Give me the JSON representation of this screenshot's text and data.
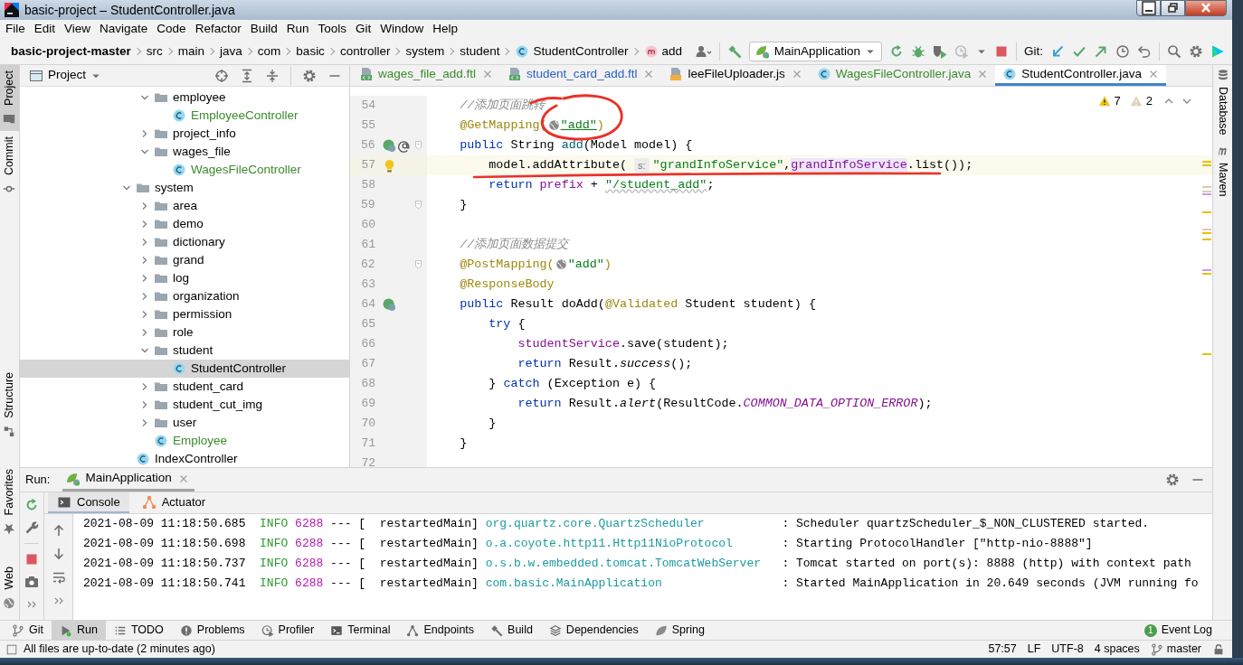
{
  "window": {
    "title": "basic-project – StudentController.java"
  },
  "menu": [
    "File",
    "Edit",
    "View",
    "Navigate",
    "Code",
    "Refactor",
    "Build",
    "Run",
    "Tools",
    "Git",
    "Window",
    "Help"
  ],
  "breadcrumbs": [
    {
      "label": "basic-project-master",
      "kind": "project"
    },
    {
      "label": "src",
      "kind": "dir"
    },
    {
      "label": "main",
      "kind": "dir"
    },
    {
      "label": "java",
      "kind": "dir"
    },
    {
      "label": "com",
      "kind": "dir"
    },
    {
      "label": "basic",
      "kind": "dir"
    },
    {
      "label": "controller",
      "kind": "dir"
    },
    {
      "label": "system",
      "kind": "dir"
    },
    {
      "label": "student",
      "kind": "dir"
    },
    {
      "label": "StudentController",
      "kind": "class"
    },
    {
      "label": "add",
      "kind": "method"
    }
  ],
  "toolbar": {
    "run_config": "MainApplication",
    "vcs_label": "Git:"
  },
  "left_stripe_top": [
    {
      "label": "Project",
      "kind": "project",
      "selected": true
    },
    {
      "label": "Commit",
      "kind": "commit",
      "selected": false
    }
  ],
  "left_stripe_bottom": [
    {
      "label": "Structure",
      "kind": "structure",
      "selected": false
    },
    {
      "label": "Favorites",
      "kind": "favorites",
      "selected": false
    },
    {
      "label": "Web",
      "kind": "web",
      "selected": false
    }
  ],
  "project_panel": {
    "title": "Project",
    "tree": [
      {
        "children": [
          {
            "label": "employee",
            "kind": "folder",
            "expanded": true,
            "selected": false,
            "children": [
              {
                "label": "EmployeeController",
                "kind": "class",
                "color": "#3c8a2e",
                "selected": false
              }
            ]
          },
          {
            "label": "project_info",
            "kind": "folder",
            "expanded": false,
            "selected": false
          },
          {
            "label": "wages_file",
            "kind": "folder",
            "expanded": true,
            "selected": false,
            "children": [
              {
                "label": "WagesFileController",
                "kind": "class",
                "color": "#3c8a2e",
                "selected": false
              }
            ]
          }
        ]
      },
      {
        "label": "system",
        "kind": "folder",
        "expanded": true,
        "selected": false,
        "children": [
          {
            "label": "area",
            "kind": "folder",
            "expanded": false,
            "selected": false
          },
          {
            "label": "demo",
            "kind": "folder",
            "expanded": false,
            "selected": false
          },
          {
            "label": "dictionary",
            "kind": "folder",
            "expanded": false,
            "selected": false
          },
          {
            "label": "grand",
            "kind": "folder",
            "expanded": false,
            "selected": false
          },
          {
            "label": "log",
            "kind": "folder",
            "expanded": false,
            "selected": false
          },
          {
            "label": "organization",
            "kind": "folder",
            "expanded": false,
            "selected": false
          },
          {
            "label": "permission",
            "kind": "folder",
            "expanded": false,
            "selected": false
          },
          {
            "label": "role",
            "kind": "folder",
            "expanded": false,
            "selected": false
          },
          {
            "label": "student",
            "kind": "folder",
            "expanded": true,
            "selected": false,
            "children": [
              {
                "label": "StudentController",
                "kind": "class",
                "selected": true
              }
            ]
          },
          {
            "label": "student_card",
            "kind": "folder",
            "expanded": false,
            "selected": false
          },
          {
            "label": "student_cut_img",
            "kind": "folder",
            "expanded": false,
            "selected": false
          },
          {
            "label": "user",
            "kind": "folder",
            "expanded": false,
            "selected": false
          },
          {
            "label": "Employee",
            "kind": "class",
            "color": "#3c8a2e",
            "selected": false
          }
        ]
      },
      {
        "label": "IndexController",
        "kind": "class",
        "selected": false
      }
    ]
  },
  "editor_tabs": [
    {
      "label": "wages_file_add.ftl",
      "kind": "ftl",
      "color": "#3c8a2e",
      "selected": false
    },
    {
      "label": "student_card_add.ftl",
      "kind": "ftl",
      "color": "#2a5fc4",
      "selected": false
    },
    {
      "label": "leeFileUploader.js",
      "kind": "js",
      "selected": false
    },
    {
      "label": "WagesFileController.java",
      "kind": "class",
      "color": "#3c8a2e",
      "selected": false
    },
    {
      "label": "StudentController.java",
      "kind": "class",
      "selected": true
    }
  ],
  "inspections": {
    "warnings": "7",
    "weak_warnings": "2"
  },
  "code_lines": [
    {
      "number": "54",
      "parts": [
        {
          "kind": "comment",
          "text": "    //添加页面跳转"
        }
      ]
    },
    {
      "number": "55",
      "parts": [
        {
          "kind": "annotation",
          "text": "    @GetMapping("
        },
        {
          "kind": "url-icon"
        },
        {
          "kind": "link-string",
          "text": "\"add\""
        },
        {
          "kind": "annotation",
          "text": ")"
        }
      ]
    },
    {
      "number": "56",
      "bean_marker": true,
      "mapping_marker": true,
      "fold": true,
      "parts": [
        {
          "kind": "keyword",
          "text": "    public "
        },
        {
          "kind": "plain",
          "text": "String "
        },
        {
          "kind": "method",
          "text": "add"
        },
        {
          "kind": "plain",
          "text": "(Model model) {"
        }
      ]
    },
    {
      "number": "57",
      "intention_bulb": true,
      "current": true,
      "parts": [
        {
          "kind": "plain",
          "text": "        model.addAttribute( "
        },
        {
          "kind": "hint",
          "text": "s:"
        },
        {
          "kind": "string",
          "text": "\"grandInfoService\""
        },
        {
          "kind": "plain",
          "text": ","
        },
        {
          "kind": "field-highlight",
          "text": "grandInfoService"
        },
        {
          "kind": "plain",
          "text": ".list());"
        }
      ]
    },
    {
      "number": "58",
      "parts": [
        {
          "kind": "keyword",
          "text": "        return "
        },
        {
          "kind": "field",
          "text": "prefix"
        },
        {
          "kind": "plain",
          "text": " + "
        },
        {
          "kind": "typo-string",
          "text": "\"/student_add\""
        },
        {
          "kind": "plain",
          "text": ";"
        }
      ]
    },
    {
      "number": "59",
      "fold": true,
      "parts": [
        {
          "kind": "plain",
          "text": "    }"
        }
      ]
    },
    {
      "number": "60"
    },
    {
      "number": "61",
      "parts": [
        {
          "kind": "comment",
          "text": "    //添加页面数据提交"
        }
      ]
    },
    {
      "number": "62",
      "fold": true,
      "parts": [
        {
          "kind": "annotation",
          "text": "    @PostMapping("
        },
        {
          "kind": "url-icon"
        },
        {
          "kind": "string",
          "text": "\"add\""
        },
        {
          "kind": "annotation",
          "text": ")"
        }
      ]
    },
    {
      "number": "63",
      "parts": [
        {
          "kind": "annotation",
          "text": "    @ResponseBody"
        }
      ]
    },
    {
      "number": "64",
      "bean_marker": true,
      "parts": [
        {
          "kind": "keyword",
          "text": "    public "
        },
        {
          "kind": "plain",
          "text": "Result doAdd("
        },
        {
          "kind": "annotation",
          "text": "@Validated"
        },
        {
          "kind": "plain",
          "text": " Student student) {"
        }
      ]
    },
    {
      "number": "65",
      "parts": [
        {
          "kind": "keyword",
          "text": "        try"
        },
        {
          "kind": "plain",
          "text": " {"
        }
      ]
    },
    {
      "number": "66",
      "parts": [
        {
          "kind": "field",
          "text": "            studentService"
        },
        {
          "kind": "plain",
          "text": ".save(student);"
        }
      ]
    },
    {
      "number": "67",
      "parts": [
        {
          "kind": "keyword",
          "text": "            return "
        },
        {
          "kind": "plain",
          "text": "Result."
        },
        {
          "kind": "static",
          "text": "success"
        },
        {
          "kind": "plain",
          "text": "();"
        }
      ]
    },
    {
      "number": "68",
      "parts": [
        {
          "kind": "plain",
          "text": "        } "
        },
        {
          "kind": "keyword",
          "text": "catch"
        },
        {
          "kind": "plain",
          "text": " (Exception e) {"
        }
      ]
    },
    {
      "number": "69",
      "parts": [
        {
          "kind": "keyword",
          "text": "            return "
        },
        {
          "kind": "plain",
          "text": "Result."
        },
        {
          "kind": "static",
          "text": "alert"
        },
        {
          "kind": "plain",
          "text": "(ResultCode."
        },
        {
          "kind": "constant",
          "text": "COMMON_DATA_OPTION_ERROR"
        },
        {
          "kind": "plain",
          "text": ");"
        }
      ]
    },
    {
      "number": "70",
      "parts": [
        {
          "kind": "plain",
          "text": "        }"
        }
      ]
    },
    {
      "number": "71",
      "parts": [
        {
          "kind": "plain",
          "text": "    }"
        }
      ]
    },
    {
      "number": "72"
    }
  ],
  "right_stripe": [
    {
      "label": "Database",
      "kind": "database"
    },
    {
      "label": "Maven",
      "kind": "maven"
    }
  ],
  "run_panel": {
    "label": "Run:",
    "tabs": [
      {
        "label": "MainApplication",
        "selected": true
      }
    ],
    "subtabs": [
      {
        "label": "Console",
        "kind": "console",
        "selected": true
      },
      {
        "label": "Actuator",
        "kind": "actuator",
        "selected": false
      }
    ],
    "log": [
      {
        "timestamp": "2021-08-09 11:18:50.685",
        "level": "INFO",
        "pid": "6288",
        "separator": "---",
        "thread": "[  restartedMain]",
        "logger": "org.quartz.core.QuartzScheduler",
        "message": ": Scheduler quartzScheduler_$_NON_CLUSTERED started."
      },
      {
        "timestamp": "2021-08-09 11:18:50.698",
        "level": "INFO",
        "pid": "6288",
        "separator": "---",
        "thread": "[  restartedMain]",
        "logger": "o.a.coyote.http11.Http11NioProtocol",
        "message": ": Starting ProtocolHandler [\"http-nio-8888\"]"
      },
      {
        "timestamp": "2021-08-09 11:18:50.737",
        "level": "INFO",
        "pid": "6288",
        "separator": "---",
        "thread": "[  restartedMain]",
        "logger": "o.s.b.w.embedded.tomcat.TomcatWebServer",
        "message": ": Tomcat started on port(s): 8888 (http) with context path"
      },
      {
        "timestamp": "2021-08-09 11:18:50.741",
        "level": "INFO",
        "pid": "6288",
        "separator": "---",
        "thread": "[  restartedMain]",
        "logger": "com.basic.MainApplication",
        "message": ": Started MainApplication in 20.649 seconds (JVM running fo"
      }
    ]
  },
  "tool_windows": [
    {
      "label": "Git",
      "kind": "git",
      "selected": false
    },
    {
      "label": "Run",
      "kind": "run",
      "selected": true
    },
    {
      "label": "TODO",
      "kind": "todo",
      "selected": false
    },
    {
      "label": "Problems",
      "kind": "problems",
      "selected": false
    },
    {
      "label": "Profiler",
      "kind": "profiler",
      "selected": false
    },
    {
      "label": "Terminal",
      "kind": "terminal",
      "selected": false
    },
    {
      "label": "Endpoints",
      "kind": "endpoints",
      "selected": false
    },
    {
      "label": "Build",
      "kind": "build",
      "selected": false
    },
    {
      "label": "Dependencies",
      "kind": "dependencies",
      "selected": false
    },
    {
      "label": "Spring",
      "kind": "spring",
      "selected": false
    }
  ],
  "event_log": {
    "label": "Event Log",
    "count": "1"
  },
  "status_bar": {
    "message": "All files are up-to-date (2 minutes ago)",
    "position": "57:57",
    "line_separator": "LF",
    "encoding": "UTF-8",
    "indent": "4 spaces",
    "branch": "master"
  }
}
